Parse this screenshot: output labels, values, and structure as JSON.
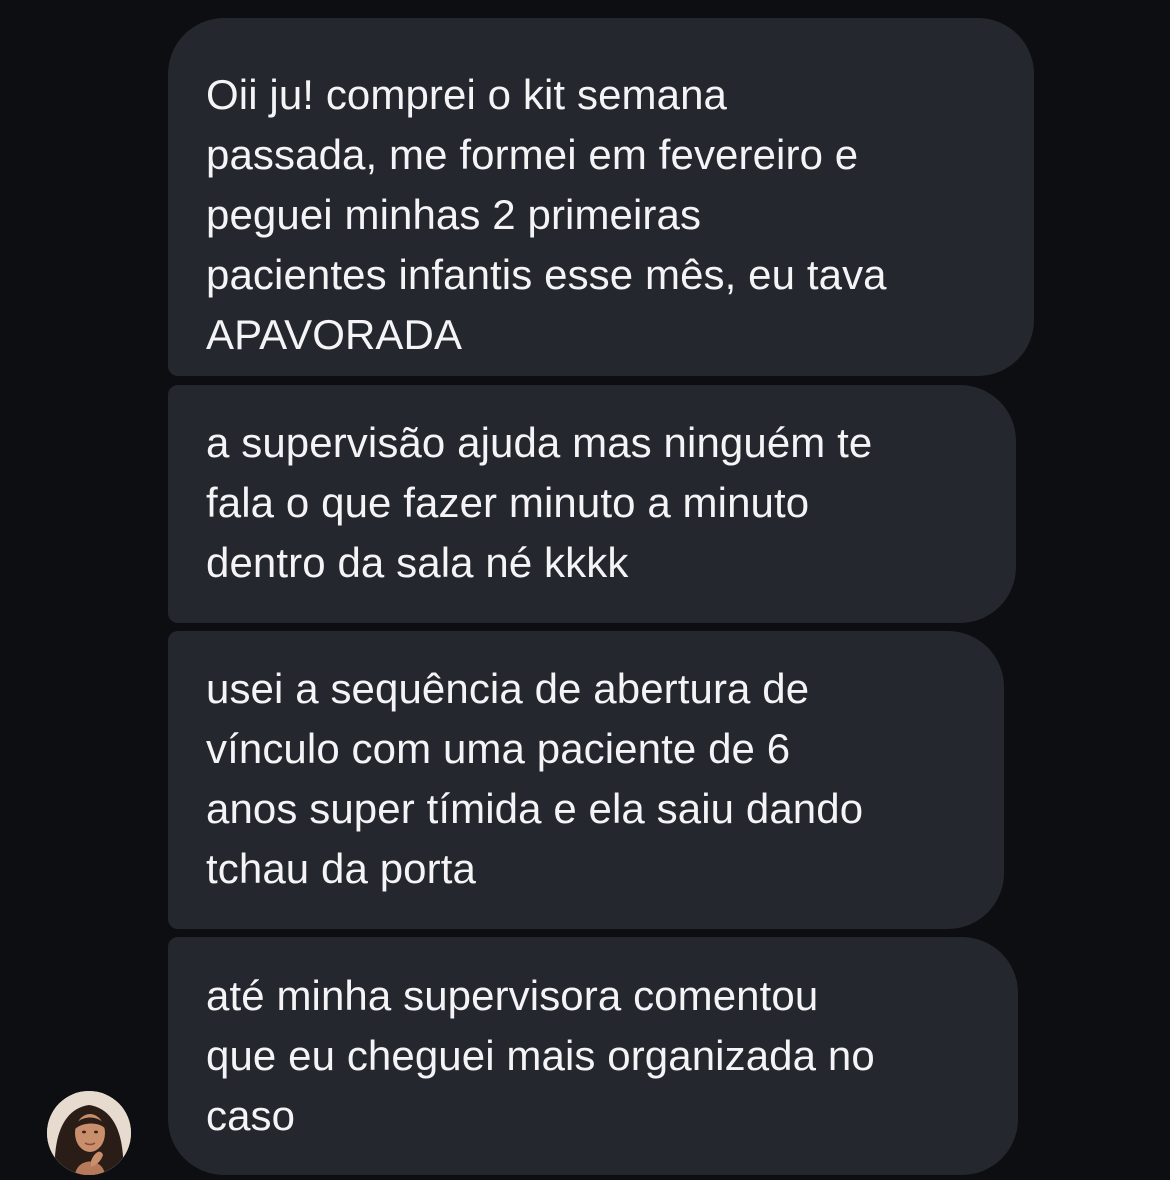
{
  "conversation": {
    "messages": [
      {
        "text": "Oii ju! comprei o kit semana\npassada, me formei em fevereiro e\npeguei minhas 2 primeiras\npacientes infantis esse mês, eu tava\nAPAVORADA"
      },
      {
        "text": "a supervisão ajuda mas ninguém te\nfala o que fazer minuto a minuto\ndentro da sala né kkkk"
      },
      {
        "text": "usei a sequência de abertura de\nvínculo com uma paciente de 6\nanos super tímida e ela saiu dando\ntchau da porta"
      },
      {
        "text": "até minha supervisora comentou\nque eu cheguei mais organizada no\ncaso"
      }
    ],
    "sender_avatar_icon": "avatar-photo-icon"
  },
  "colors": {
    "background": "#0c0e12",
    "bubble": "#25272e",
    "text": "#f4f4f6"
  }
}
